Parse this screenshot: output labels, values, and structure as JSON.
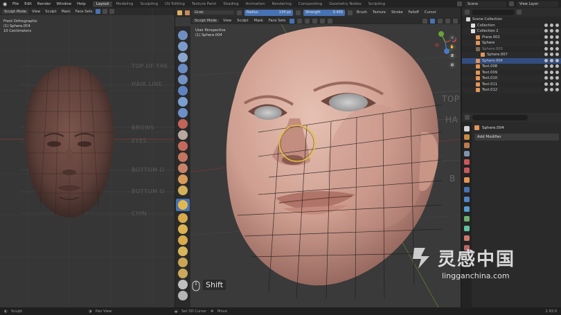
{
  "menubar": {
    "menus": [
      "File",
      "Edit",
      "Render",
      "Window",
      "Help"
    ],
    "workspaces": [
      "Layout",
      "Modeling",
      "Sculpting",
      "UV Editing",
      "Texture Paint",
      "Shading",
      "Animation",
      "Rendering",
      "Compositing",
      "Geometry Nodes",
      "Scripting"
    ],
    "active_workspace": "Layout",
    "scene": "Scene",
    "view_layer": "View Layer"
  },
  "left_viewport": {
    "mode": "Sculpt Mode",
    "menus": [
      "View",
      "Sculpt",
      "Mask",
      "Face Sets"
    ],
    "view_name": "Front Orthographic",
    "object": "(1) Sphere.004",
    "scale": "10 Centimeters",
    "ref_labels": [
      "TOP OF THE",
      "HAIR LINE",
      "BROWS",
      "EYES",
      "BOTTOM O",
      "BOTTOM O",
      "CHIN"
    ]
  },
  "main_viewport": {
    "brush": "Grab",
    "radius_label": "Radius",
    "radius_value": "134 px",
    "strength_label": "Strength",
    "strength_value": "0.400",
    "header_menus": [
      "Brush",
      "Texture",
      "Stroke",
      "Falloff",
      "Cursor"
    ],
    "mode": "Sculpt Mode",
    "menus": [
      "View",
      "Sculpt",
      "Mask",
      "Face Sets"
    ],
    "view_name": "User Perspective",
    "object": "(1) Sphere.004",
    "key_hint": "Shift",
    "ref_labels": [
      "TOP",
      "HA",
      "B"
    ]
  },
  "outliner": {
    "root": "Scene Collection",
    "rows": [
      {
        "label": "Collection",
        "indent": 1,
        "kind": "collection",
        "selected": false
      },
      {
        "label": "Collection 2",
        "indent": 1,
        "kind": "collection",
        "selected": false
      },
      {
        "label": "Plane.002",
        "indent": 2,
        "kind": "mesh",
        "selected": false
      },
      {
        "label": "Sphere",
        "indent": 2,
        "kind": "mesh",
        "selected": false
      },
      {
        "label": "Sphere.003",
        "indent": 2,
        "kind": "mesh-dim",
        "selected": false
      },
      {
        "label": "Sphere.007",
        "indent": 3,
        "kind": "mesh",
        "selected": false
      },
      {
        "label": "Sphere.004",
        "indent": 2,
        "kind": "mesh",
        "selected": true
      },
      {
        "label": "Text.008",
        "indent": 2,
        "kind": "text",
        "selected": false
      },
      {
        "label": "Text.009",
        "indent": 2,
        "kind": "text",
        "selected": false
      },
      {
        "label": "Text.010",
        "indent": 2,
        "kind": "text",
        "selected": false
      },
      {
        "label": "Text.011",
        "indent": 2,
        "kind": "text",
        "selected": false
      },
      {
        "label": "Text.012",
        "indent": 2,
        "kind": "text",
        "selected": false
      }
    ]
  },
  "properties": {
    "object_name": "Sphere.004",
    "add_modifier": "Add Modifier"
  },
  "status_bar": {
    "left": "Sculpt",
    "mid1": "Pan View",
    "mid2": "Set 3D Cursor",
    "mid3": "Move",
    "version": "2.93.0"
  },
  "watermark": {
    "title": "灵感中国",
    "url": "lingganchina.com"
  },
  "colors": {
    "accent": "#4772b3",
    "skin": "#d8aa9b",
    "skin_shadow": "#a8736a",
    "clay": "#6e4b44",
    "grid_line": "#1a1a1a",
    "brush_ring": "#e5c043"
  }
}
